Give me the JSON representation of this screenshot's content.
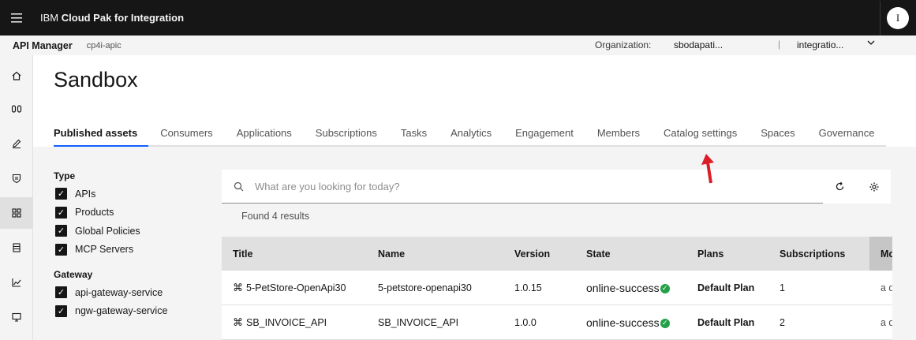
{
  "header": {
    "brand_prefix": "IBM",
    "brand_name": "Cloud Pak for Integration",
    "avatar_initial": "I"
  },
  "subheader": {
    "product": "API Manager",
    "instance": "cp4i-apic",
    "org_label": "Organization:",
    "org_value": "sbodapati...",
    "separator": "|",
    "catalog_value": "integratio..."
  },
  "sidenav": {
    "icons": [
      "home-icon",
      "apis-icon",
      "edit-icon",
      "security-icon",
      "catalogs-icon",
      "data-icon",
      "analytics-icon",
      "monitor-icon"
    ],
    "active_index": 4
  },
  "page": {
    "title": "Sandbox"
  },
  "tabs": [
    {
      "label": "Published assets",
      "active": true
    },
    {
      "label": "Consumers",
      "active": false
    },
    {
      "label": "Applications",
      "active": false
    },
    {
      "label": "Subscriptions",
      "active": false
    },
    {
      "label": "Tasks",
      "active": false
    },
    {
      "label": "Analytics",
      "active": false
    },
    {
      "label": "Engagement",
      "active": false
    },
    {
      "label": "Members",
      "active": false
    },
    {
      "label": "Catalog settings",
      "active": false
    },
    {
      "label": "Spaces",
      "active": false
    },
    {
      "label": "Governance",
      "active": false
    }
  ],
  "filters": {
    "type_heading": "Type",
    "type_options": [
      "APIs",
      "Products",
      "Global Policies",
      "MCP Servers"
    ],
    "gateway_heading": "Gateway",
    "gateway_options": [
      "api-gateway-service",
      "ngw-gateway-service"
    ]
  },
  "search": {
    "placeholder": "What are you looking for today?",
    "results_text": "Found 4 results"
  },
  "table": {
    "columns": [
      "Title",
      "Name",
      "Version",
      "State",
      "Plans",
      "Subscriptions",
      "Mo"
    ],
    "rows": [
      {
        "title": "5-PetStore-OpenApi30",
        "name": "5-petstore-openapi30",
        "version": "1.0.15",
        "state": "online-success",
        "plan": "Default Plan",
        "subscriptions": "1",
        "modified": "a d"
      },
      {
        "title": "SB_INVOICE_API",
        "name": "SB_INVOICE_API",
        "version": "1.0.0",
        "state": "online-success",
        "plan": "Default Plan",
        "subscriptions": "2",
        "modified": "a d"
      }
    ]
  },
  "colors": {
    "header_bg": "#161616",
    "active_tab": "#0f62fe",
    "success": "#24a148",
    "annotation_arrow": "#da1e28"
  }
}
